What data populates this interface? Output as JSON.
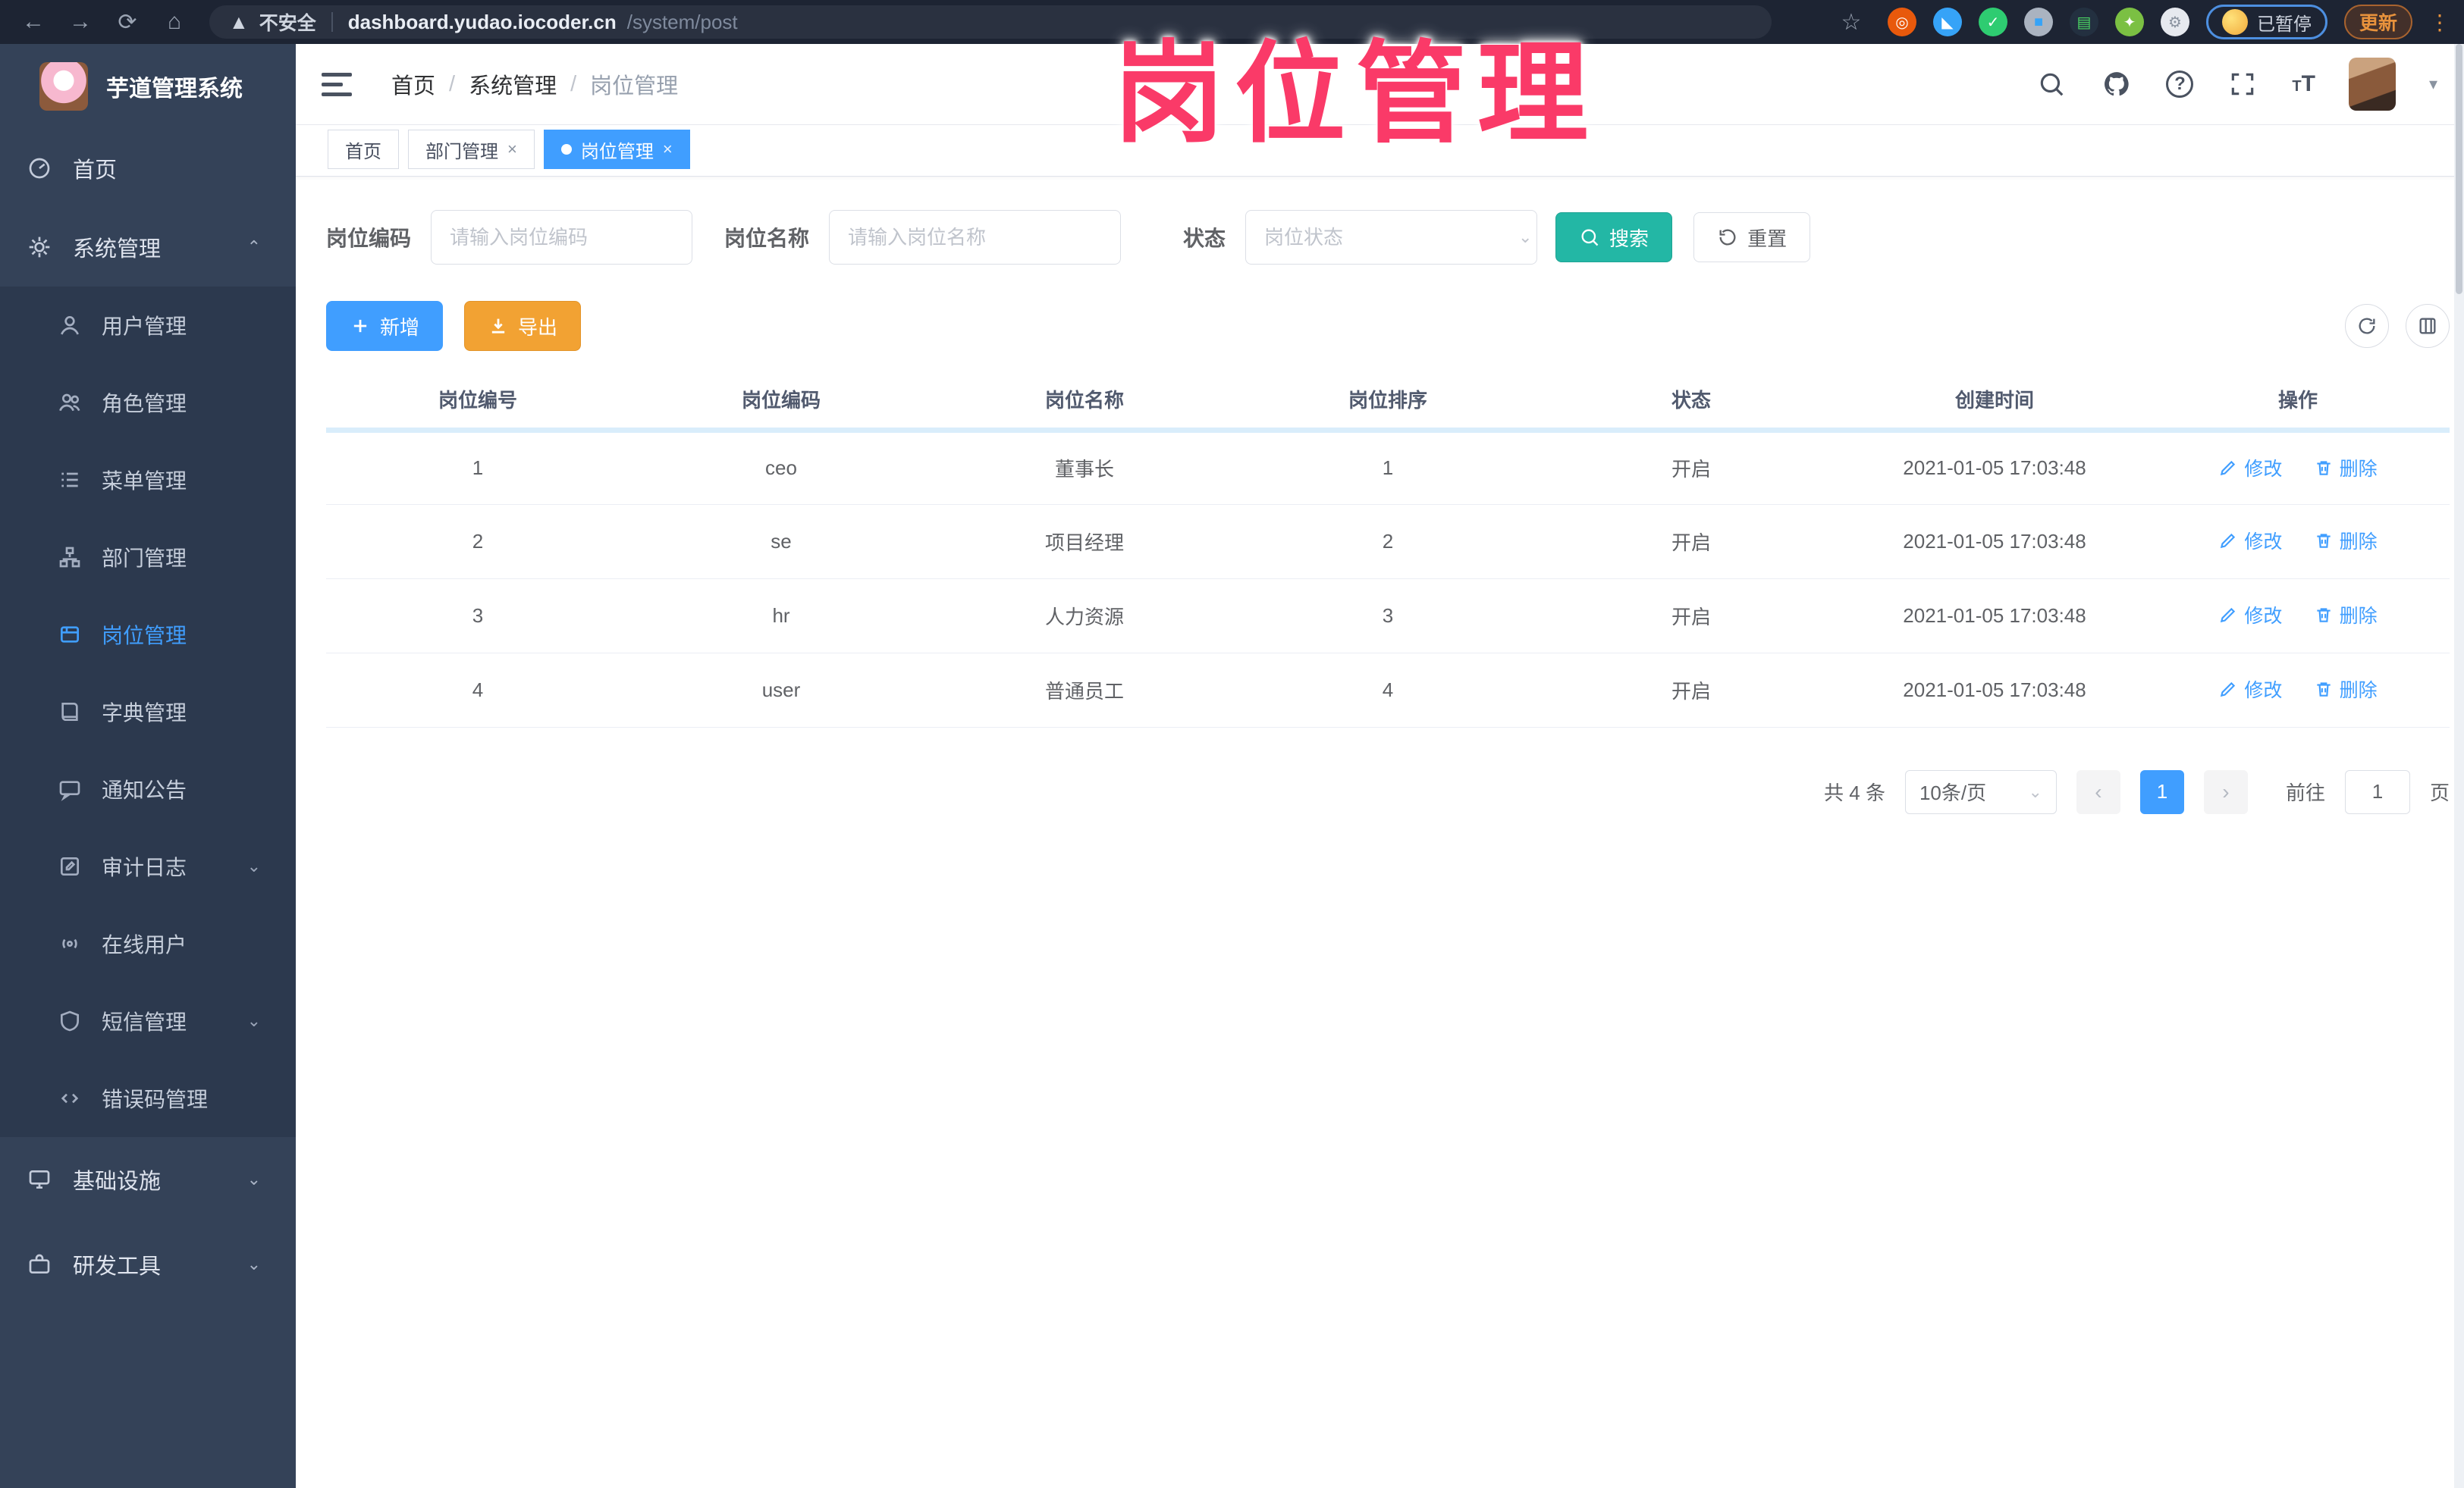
{
  "colors": {
    "primary": "#409eff",
    "teal": "#23b7a5",
    "warning": "#f2a233",
    "overlay_pink": "#fa3a68",
    "sidebar_bg": "#344258",
    "submenu_bg": "#2c394e"
  },
  "browser": {
    "security_label": "不安全",
    "url_host": "dashboard.yudao.iocoder.cn",
    "url_path": "/system/post",
    "paused_badge": "已暂停",
    "update_label": "更新"
  },
  "overlay": {
    "title": "岗位管理"
  },
  "sidebar": {
    "app_title": "芋道管理系统",
    "home": "首页",
    "system": "系统管理",
    "system_children": [
      "用户管理",
      "角色管理",
      "菜单管理",
      "部门管理",
      "岗位管理",
      "字典管理",
      "通知公告",
      "审计日志",
      "在线用户",
      "短信管理",
      "错误码管理"
    ],
    "infra": "基础设施",
    "devtools": "研发工具"
  },
  "header": {
    "breadcrumb": [
      "首页",
      "系统管理",
      "岗位管理"
    ],
    "tabs": [
      {
        "label": "首页"
      },
      {
        "label": "部门管理"
      },
      {
        "label": "岗位管理"
      }
    ]
  },
  "filters": {
    "code_label": "岗位编码",
    "code_placeholder": "请输入岗位编码",
    "name_label": "岗位名称",
    "name_placeholder": "请输入岗位名称",
    "status_label": "状态",
    "status_placeholder": "岗位状态",
    "search_label": "搜索",
    "reset_label": "重置"
  },
  "toolbar": {
    "add_label": "新增",
    "export_label": "导出"
  },
  "table": {
    "headers": [
      "岗位编号",
      "岗位编码",
      "岗位名称",
      "岗位排序",
      "状态",
      "创建时间",
      "操作"
    ],
    "rows": [
      {
        "id": "1",
        "code": "ceo",
        "name": "董事长",
        "sort": "1",
        "status": "开启",
        "created": "2021-01-05 17:03:48"
      },
      {
        "id": "2",
        "code": "se",
        "name": "项目经理",
        "sort": "2",
        "status": "开启",
        "created": "2021-01-05 17:03:48"
      },
      {
        "id": "3",
        "code": "hr",
        "name": "人力资源",
        "sort": "3",
        "status": "开启",
        "created": "2021-01-05 17:03:48"
      },
      {
        "id": "4",
        "code": "user",
        "name": "普通员工",
        "sort": "4",
        "status": "开启",
        "created": "2021-01-05 17:03:48"
      }
    ],
    "edit_label": "修改",
    "delete_label": "删除"
  },
  "pagination": {
    "total": "共 4 条",
    "page_size": "10条/页",
    "page": "1",
    "goto_label": "前往",
    "goto_value": "1",
    "goto_suffix": "页"
  }
}
